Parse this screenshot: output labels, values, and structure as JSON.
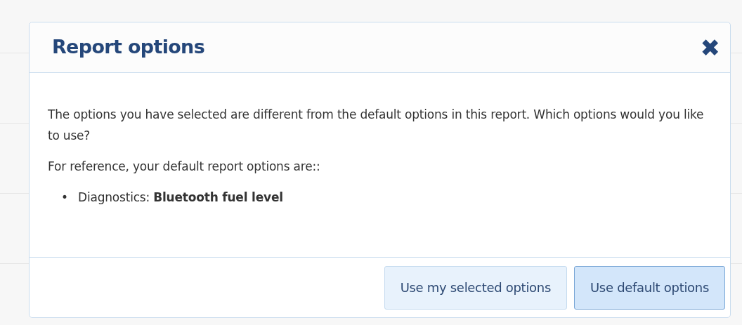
{
  "dialog": {
    "title": "Report options",
    "close_glyph": "✖",
    "paragraphs": [
      "The options you have selected are different from the default options in this report. Which options would you like to use?",
      "For reference, your default report options are::"
    ],
    "list": [
      {
        "bullet": "•",
        "text": "Diagnostics: **Bluetooth fuel level**"
      }
    ],
    "buttons": [
      {
        "label": "Use my selected options",
        "primary": false
      },
      {
        "label": "Use default options",
        "primary": true
      }
    ]
  }
}
